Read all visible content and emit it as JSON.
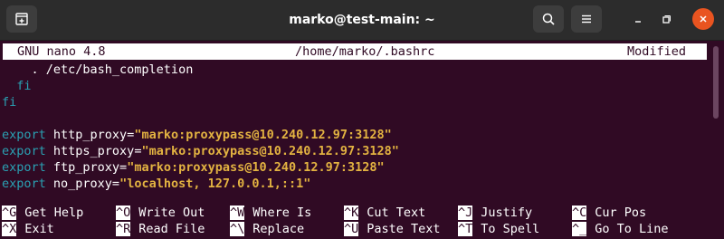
{
  "window": {
    "title": "marko@test-main: ~",
    "icons": {
      "new_tab": "new-tab-icon",
      "search": "search-icon",
      "menu": "hamburger-menu-icon",
      "minimize": "minimize-icon",
      "maximize": "maximize-icon",
      "close": "close-icon"
    },
    "colors": {
      "titlebar": "#2c2c2c",
      "close": "#e95420",
      "terminal_bg": "#300a24"
    }
  },
  "nano": {
    "version": "GNU nano 4.8",
    "file": "/home/marko/.bashrc",
    "status": "Modified"
  },
  "lines": [
    {
      "parts": [
        {
          "text": "    . /etc/bash_completion",
          "style": "plain"
        }
      ]
    },
    {
      "parts": [
        {
          "text": "  fi",
          "style": "kw"
        }
      ]
    },
    {
      "parts": [
        {
          "text": "fi",
          "style": "kw"
        }
      ]
    },
    {
      "parts": [
        {
          "text": "",
          "style": "plain"
        }
      ]
    },
    {
      "parts": [
        {
          "text": "export",
          "style": "kw"
        },
        {
          "text": " http_proxy=",
          "style": "plain"
        },
        {
          "text": "\"marko:proxypass@10.240.12.97:3128\"",
          "style": "str"
        }
      ]
    },
    {
      "parts": [
        {
          "text": "export",
          "style": "kw"
        },
        {
          "text": " https_proxy=",
          "style": "plain"
        },
        {
          "text": "\"marko:proxypass@10.240.12.97:3128\"",
          "style": "str"
        }
      ]
    },
    {
      "parts": [
        {
          "text": "export",
          "style": "kw"
        },
        {
          "text": " ftp_proxy=",
          "style": "plain"
        },
        {
          "text": "\"marko:proxypass@10.240.12.97:3128\"",
          "style": "str"
        }
      ]
    },
    {
      "parts": [
        {
          "text": "export",
          "style": "kw"
        },
        {
          "text": " no_proxy=",
          "style": "plain"
        },
        {
          "text": "\"localhost, 127.0.0.1,::1\"",
          "style": "str"
        }
      ]
    }
  ],
  "shortcuts": [
    [
      {
        "key": "^G",
        "label": "Get Help"
      },
      {
        "key": "^O",
        "label": "Write Out"
      },
      {
        "key": "^W",
        "label": "Where Is"
      },
      {
        "key": "^K",
        "label": "Cut Text"
      },
      {
        "key": "^J",
        "label": "Justify"
      },
      {
        "key": "^C",
        "label": "Cur Pos"
      }
    ],
    [
      {
        "key": "^X",
        "label": "Exit"
      },
      {
        "key": "^R",
        "label": "Read File"
      },
      {
        "key": "^\\",
        "label": "Replace"
      },
      {
        "key": "^U",
        "label": "Paste Text"
      },
      {
        "key": "^T",
        "label": "To Spell"
      },
      {
        "key": "^_",
        "label": "Go To Line"
      }
    ]
  ]
}
